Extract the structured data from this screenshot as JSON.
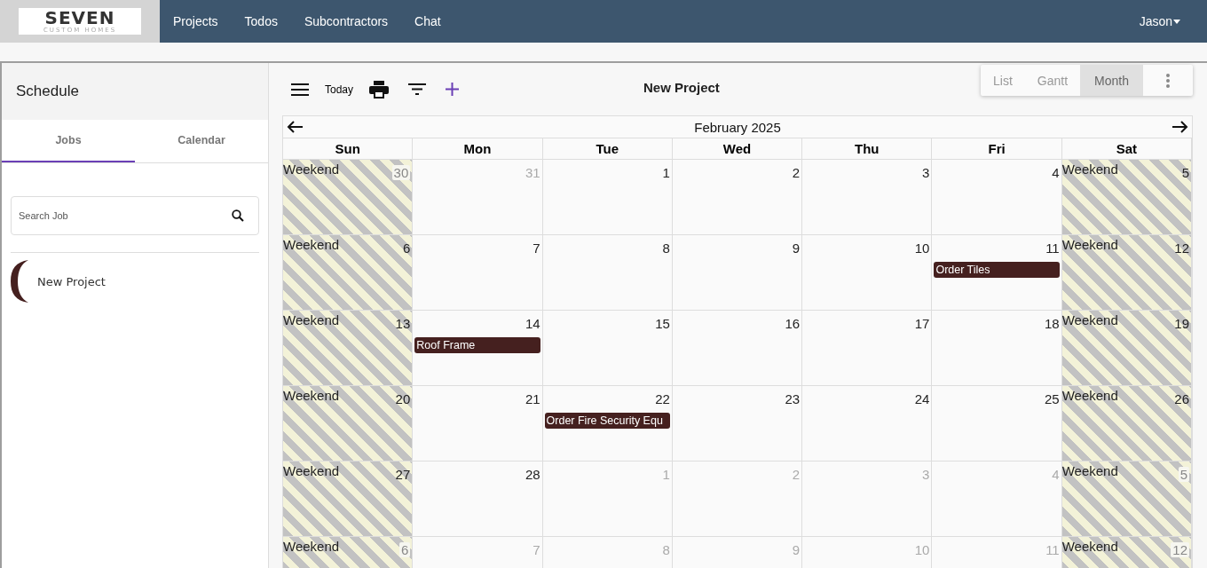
{
  "logo": {
    "name": "SEVEN",
    "tagline": "CUSTOM HOMES"
  },
  "nav": [
    {
      "label": "Projects"
    },
    {
      "label": "Todos"
    },
    {
      "label": "Subcontractors"
    },
    {
      "label": "Chat"
    }
  ],
  "user": {
    "name": "Jason"
  },
  "sidebar": {
    "title": "Schedule",
    "tabs": [
      {
        "label": "Jobs",
        "selected": true
      },
      {
        "label": "Calendar",
        "selected": false
      }
    ],
    "search": {
      "placeholder": "Search Job"
    },
    "jobs": [
      {
        "name": "New Project",
        "color": "#45201f"
      }
    ]
  },
  "toolbar": {
    "today": "Today",
    "title": "New Project",
    "views": [
      {
        "label": "List",
        "selected": false
      },
      {
        "label": "Gantt",
        "selected": false
      },
      {
        "label": "Month",
        "selected": true
      }
    ]
  },
  "calendar": {
    "month": "February 2025",
    "weekdays": [
      "Sun",
      "Mon",
      "Tue",
      "Wed",
      "Thu",
      "Fri",
      "Sat"
    ],
    "weeks": [
      [
        {
          "date": "30",
          "outside": true,
          "weekend": "Weekend"
        },
        {
          "date": "31",
          "outside": true
        },
        {
          "date": "1",
          "outside": false
        },
        {
          "date": "2",
          "outside": false
        },
        {
          "date": "3",
          "outside": false
        },
        {
          "date": "4",
          "outside": false
        },
        {
          "date": "5",
          "outside": false,
          "weekend": "Weekend"
        }
      ],
      [
        {
          "date": "6",
          "outside": false,
          "weekend": "Weekend"
        },
        {
          "date": "7",
          "outside": false
        },
        {
          "date": "8",
          "outside": false
        },
        {
          "date": "9",
          "outside": false
        },
        {
          "date": "10",
          "outside": false
        },
        {
          "date": "11",
          "outside": false,
          "events": [
            {
              "title": "Order Tiles",
              "color": "#45201f"
            }
          ]
        },
        {
          "date": "12",
          "outside": false,
          "weekend": "Weekend"
        }
      ],
      [
        {
          "date": "13",
          "outside": false,
          "weekend": "Weekend"
        },
        {
          "date": "14",
          "outside": false,
          "events": [
            {
              "title": "Roof Frame",
              "color": "#45201f"
            }
          ]
        },
        {
          "date": "15",
          "outside": false
        },
        {
          "date": "16",
          "outside": false
        },
        {
          "date": "17",
          "outside": false
        },
        {
          "date": "18",
          "outside": false
        },
        {
          "date": "19",
          "outside": false,
          "weekend": "Weekend"
        }
      ],
      [
        {
          "date": "20",
          "outside": false,
          "weekend": "Weekend"
        },
        {
          "date": "21",
          "outside": false
        },
        {
          "date": "22",
          "outside": false,
          "events": [
            {
              "title": "Order Fire Security Equ",
              "color": "#45201f"
            }
          ]
        },
        {
          "date": "23",
          "outside": false
        },
        {
          "date": "24",
          "outside": false
        },
        {
          "date": "25",
          "outside": false
        },
        {
          "date": "26",
          "outside": false,
          "weekend": "Weekend"
        }
      ],
      [
        {
          "date": "27",
          "outside": false,
          "weekend": "Weekend"
        },
        {
          "date": "28",
          "outside": false
        },
        {
          "date": "1",
          "outside": true
        },
        {
          "date": "2",
          "outside": true
        },
        {
          "date": "3",
          "outside": true
        },
        {
          "date": "4",
          "outside": true
        },
        {
          "date": "5",
          "outside": true,
          "weekend": "Weekend"
        }
      ],
      [
        {
          "date": "6",
          "outside": true,
          "weekend": "Weekend"
        },
        {
          "date": "7",
          "outside": true
        },
        {
          "date": "8",
          "outside": true
        },
        {
          "date": "9",
          "outside": true
        },
        {
          "date": "10",
          "outside": true
        },
        {
          "date": "11",
          "outside": true
        },
        {
          "date": "12",
          "outside": true,
          "weekend": "Weekend"
        }
      ]
    ]
  }
}
